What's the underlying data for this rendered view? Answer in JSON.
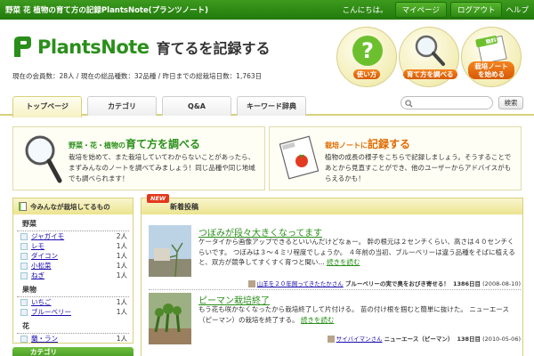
{
  "topbar": {
    "site_title": "野菜 花 植物の育て方の記録PlantsNote(プランツノート)",
    "greeting": "こんにちは。",
    "mypage": "マイページ",
    "logout": "ログアウト",
    "help": "ヘルプ"
  },
  "header": {
    "logo_name": "PlantsNote",
    "tagline": "育てるを記録する",
    "stats": "現在の会員数：28人 / 現在の総品種数：32品種 / 昨日までの総栽培日数：1,763日"
  },
  "circles": [
    {
      "label": "使い方",
      "icon": "question-icon"
    },
    {
      "label": "育て方を調べる",
      "icon": "magnifier-icon"
    },
    {
      "label": "栽培ノートを始める",
      "icon": "notebook-icon",
      "badge": "無料"
    }
  ],
  "nav": {
    "tabs": [
      "トップページ",
      "カテゴリ",
      "Q&A",
      "キーワード辞典"
    ],
    "search_button": "検索"
  },
  "promo1": {
    "title_pre": "野菜・花・植物の",
    "title_big": "育て方を調べる",
    "text": "栽培を始めて、また栽培していてわからないことがあったら、まずみんなのノートを調べてみましょう！同じ品種や同じ地域でも調べられます！"
  },
  "promo2": {
    "title_pre": "栽培ノートに",
    "title_big": "記録する",
    "text": "植物の成長の様子をこちらで記録しましょう。そうすることであとから見直すことができ、他のユーザーからアドバイスがもらえるかも！"
  },
  "sidebar": {
    "title": "今みんなが栽培してるもの",
    "categories": [
      {
        "name": "野菜",
        "items": [
          {
            "name": "ジャガイモ",
            "count": "2人"
          },
          {
            "name": "レモ",
            "count": "1人"
          },
          {
            "name": "ダイコン",
            "count": "1人"
          },
          {
            "name": "小松菜",
            "count": "1人"
          },
          {
            "name": "ねぎ",
            "count": "1人"
          }
        ]
      },
      {
        "name": "果物",
        "items": [
          {
            "name": "いちご",
            "count": "1人"
          },
          {
            "name": "ブルーベリー",
            "count": "1人"
          }
        ]
      },
      {
        "name": "花",
        "items": [
          {
            "name": "蘭・ラン",
            "count": "1人"
          }
        ]
      }
    ],
    "next_title": "カテゴリ"
  },
  "main": {
    "new_badge": "NEW",
    "title": "新着投稿",
    "posts": [
      {
        "title": "つぼみが段々大きくなってます",
        "body": "ケータイから画像アップできるといいんだけどなぁー。 幹の根元は２センチくらい、高さは４０センチくらいです。 つぼみは３～４ミリ程度でしょうか。 ４年前の当初、ブルーベリーは違う品種をそばに植えると、双方が競争してすくすく育つと聞い...",
        "more": "続きを読む",
        "user": "山羊を２０年飼ってきたたかさん",
        "note": "ブルーベリーの実で奥をおびき寄せる！",
        "days": "1386日目",
        "date": "(2008-08-10)"
      },
      {
        "title": "ピーマン栽培終了",
        "body": "もう花も咲かなくなったから栽培終了して片付ける。 苗の付け根を掴むと簡単に抜けた。 ニューエース（ピーマン）の栽培を終了する。",
        "more": "続きを読む",
        "user": "サイバイマンさん",
        "note": "ニューエース（ピーマン）",
        "days": "138日目",
        "date": "(2010-05-06)"
      }
    ]
  }
}
